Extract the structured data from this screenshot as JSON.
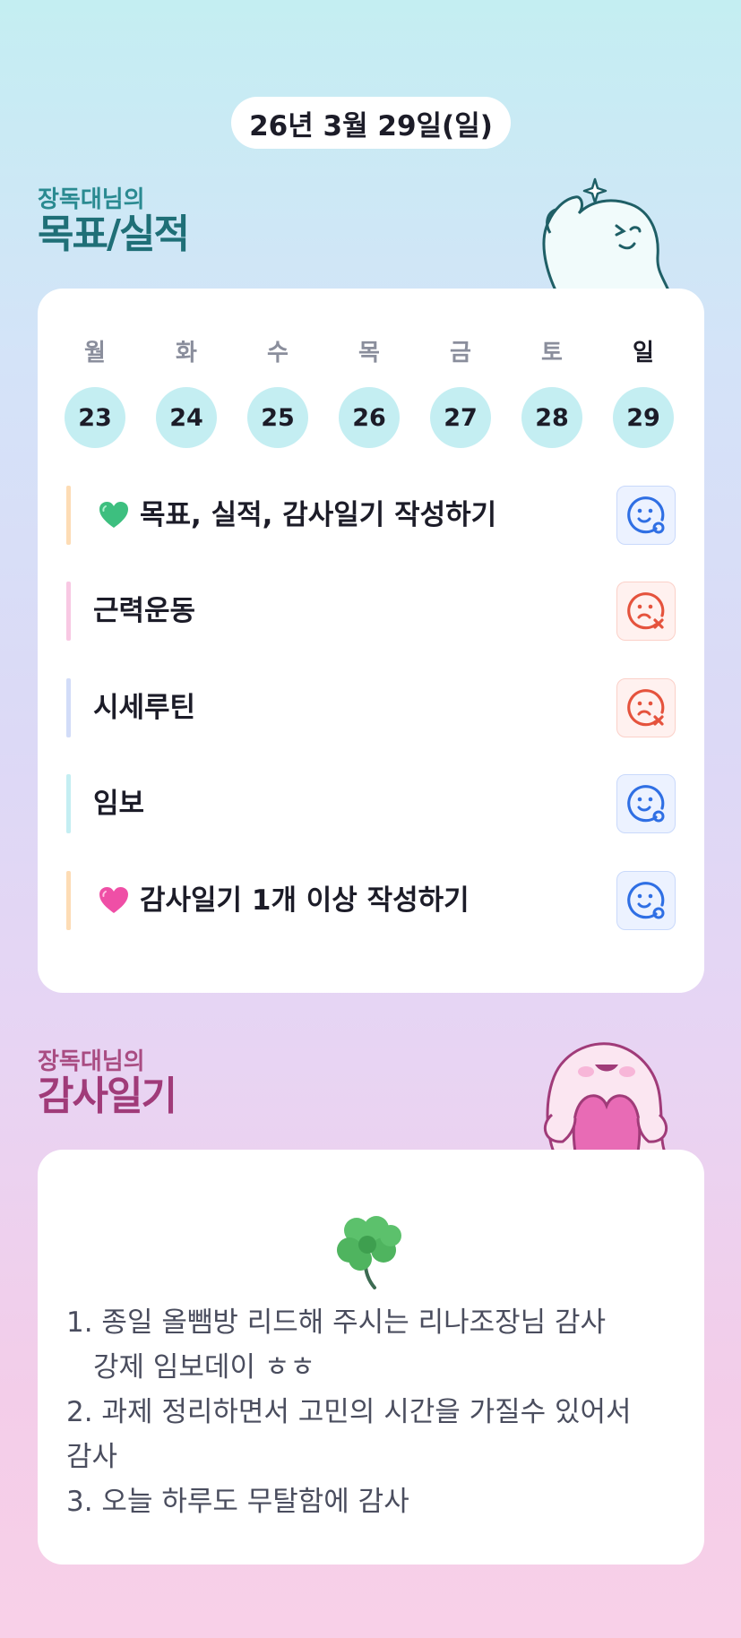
{
  "header": {
    "date": "26년 3월 29일(일)"
  },
  "goals_section": {
    "owner_label": "장독대님의",
    "title": "목표/실적"
  },
  "week": [
    {
      "label": "월",
      "day": "23",
      "today": false
    },
    {
      "label": "화",
      "day": "24",
      "today": false
    },
    {
      "label": "수",
      "day": "25",
      "today": false
    },
    {
      "label": "목",
      "day": "26",
      "today": false
    },
    {
      "label": "금",
      "day": "27",
      "today": false
    },
    {
      "label": "토",
      "day": "28",
      "today": false
    },
    {
      "label": "일",
      "day": "29",
      "today": true
    }
  ],
  "goals": [
    {
      "text": "목표, 실적, 감사일기 작성하기",
      "icon": "green-heart-icon",
      "bar_color": "#fddcb5",
      "status": "done"
    },
    {
      "text": "근력운동",
      "icon": null,
      "bar_color": "#f8c8e3",
      "status": "fail"
    },
    {
      "text": "시세루틴",
      "icon": null,
      "bar_color": "#d2dcf8",
      "status": "fail"
    },
    {
      "text": "임보",
      "icon": null,
      "bar_color": "#c4eef2",
      "status": "done"
    },
    {
      "text": "감사일기 1개 이상 작성하기",
      "icon": "pink-heart-icon",
      "bar_color": "#fddcb5",
      "status": "done"
    }
  ],
  "thanks_section": {
    "owner_label": "장독대님의",
    "title": "감사일기"
  },
  "diary": [
    {
      "text": "1. 종일 올뺌방 리드해 주시는 리나조장님 감사",
      "indent": false
    },
    {
      "text": "강제 임보데이 ㅎㅎ",
      "indent": true
    },
    {
      "text": "2. 과제 정리하면서 고민의 시간을 가질수 있어서",
      "indent": false
    },
    {
      "text": "감사",
      "indent": false
    },
    {
      "text": "3. 오늘 하루도 무탈함에 감사",
      "indent": false
    }
  ],
  "colors": {
    "done": "#2f6fe4",
    "fail": "#e5533d",
    "day_circle": "#c4eef2"
  }
}
